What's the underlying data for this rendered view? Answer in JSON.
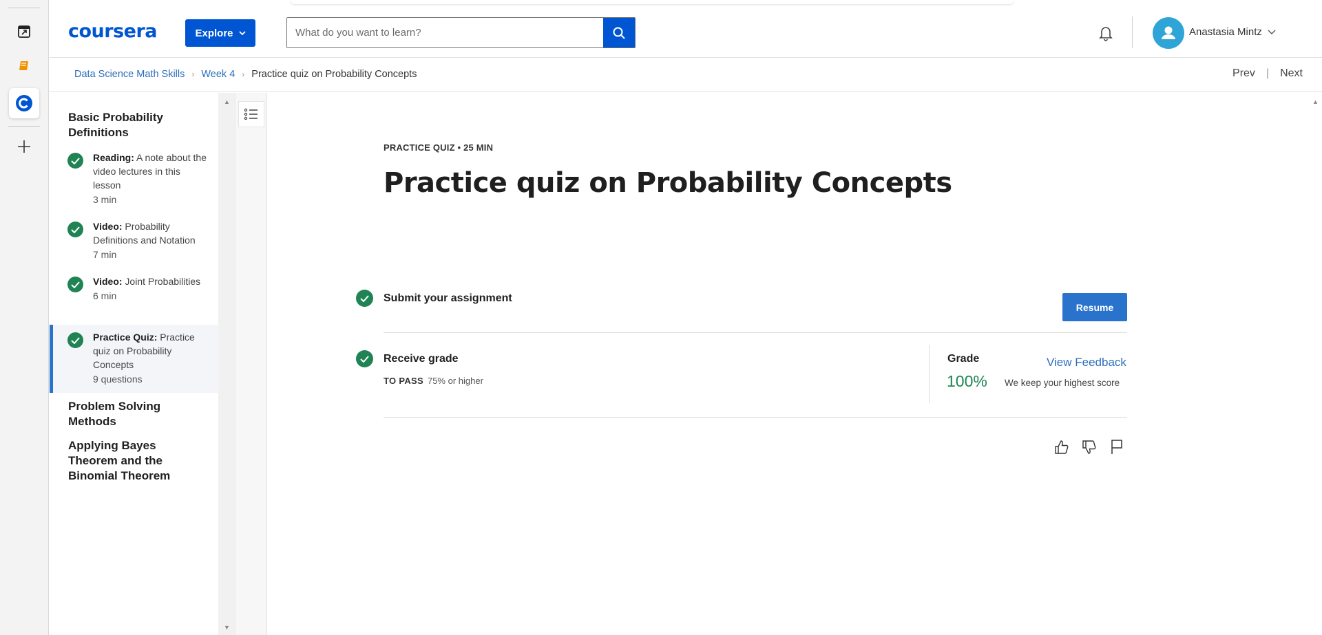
{
  "header": {
    "logo": "coursera",
    "explore_label": "Explore",
    "search_placeholder": "What do you want to learn?",
    "user_name": "Anastasia Mintz"
  },
  "breadcrumb": {
    "items": [
      "Data Science Math Skills",
      "Week 4"
    ],
    "current": "Practice quiz on Probability Concepts"
  },
  "nav": {
    "prev": "Prev",
    "sep": "|",
    "next": "Next"
  },
  "sidebar": {
    "sections": [
      {
        "title": "Basic Probability Definitions"
      },
      {
        "title": "Problem Solving Methods"
      },
      {
        "title": "Applying Bayes Theorem and the Binomial Theorem"
      }
    ],
    "items": [
      {
        "type": "Reading:",
        "text": "A note about the video lectures in this lesson",
        "meta": "3 min",
        "completed": true
      },
      {
        "type": "Video:",
        "text": "Probability Definitions and Notation",
        "meta": "7 min",
        "completed": true
      },
      {
        "type": "Video:",
        "text": "Joint Probabilities",
        "meta": "6 min",
        "completed": true
      },
      {
        "type": "Practice Quiz:",
        "text": "Practice quiz on Probability Concepts",
        "meta": "9 questions",
        "completed": true,
        "selected": true
      }
    ]
  },
  "main": {
    "kicker": "PRACTICE QUIZ • 25 MIN",
    "title": "Practice quiz on Probability Concepts",
    "submit_label": "Submit your assignment",
    "resume_label": "Resume",
    "receive_label": "Receive grade",
    "to_pass_label": "TO PASS",
    "to_pass_value": "75% or higher",
    "grade_heading": "Grade",
    "grade_value": "100%",
    "view_feedback": "View Feedback",
    "keep_note": "We keep your highest score"
  },
  "colors": {
    "brand": "#0056d2",
    "success": "#1f8354",
    "link": "#2a6ebb",
    "accent_button": "#2a73cc"
  },
  "icons": {
    "rail": [
      "external-tab-icon",
      "book-icon",
      "coursera-c-icon",
      "plus-icon"
    ],
    "header": [
      "chevron-down-icon",
      "search-icon",
      "bell-icon",
      "user-icon"
    ],
    "actions": [
      "thumbs-up-icon",
      "thumbs-down-icon",
      "flag-icon"
    ]
  }
}
